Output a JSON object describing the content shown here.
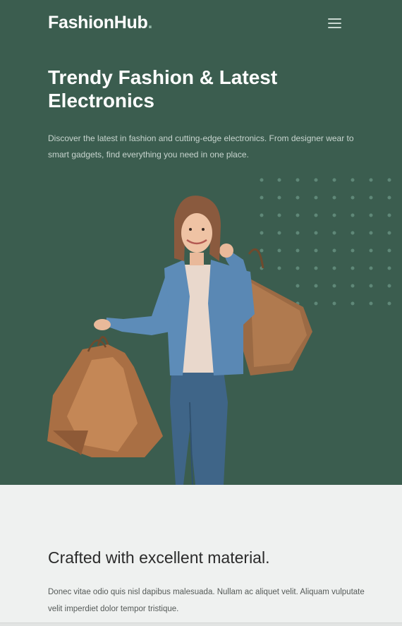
{
  "header": {
    "logo_text": "FashionHub",
    "logo_dot": ".",
    "menu_icon": "hamburger-menu-icon"
  },
  "hero": {
    "title": "Trendy Fashion & Latest Electronics",
    "description": "Discover the latest in fashion and cutting-edge electronics. From designer wear to smart gadgets, find everything you need in one place.",
    "background_color": "#3b5d4f",
    "image": "woman-with-shopping-bags"
  },
  "section": {
    "title": "Crafted with excellent material.",
    "text": "Donec vitae odio quis nisl dapibus malesuada. Nullam ac aliquet velit. Aliquam vulputate velit imperdiet dolor tempor tristique."
  }
}
